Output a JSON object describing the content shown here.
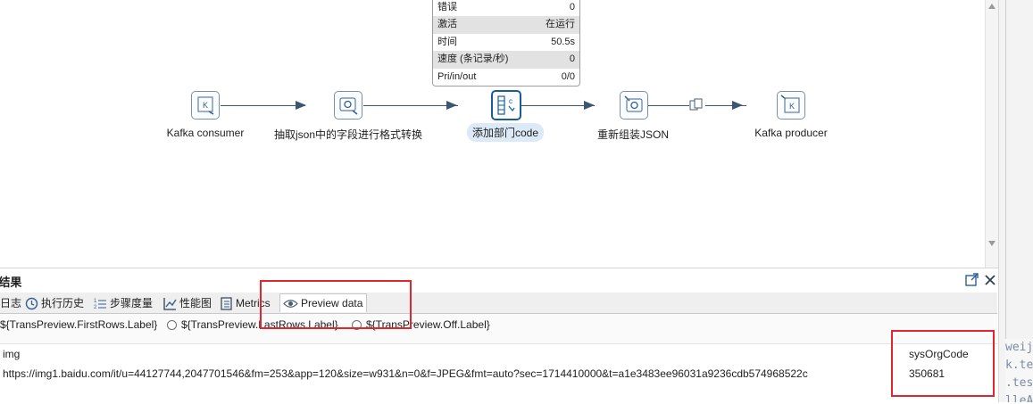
{
  "metrics_tooltip": [
    {
      "label": "错误",
      "value": "0"
    },
    {
      "label": "激活",
      "value": "在运行"
    },
    {
      "label": "时间",
      "value": "50.5s"
    },
    {
      "label": "速度 (条记录/秒)",
      "value": "0"
    },
    {
      "label": "Pri/in/out",
      "value": "0/0"
    }
  ],
  "steps": [
    {
      "label": "Kafka consumer"
    },
    {
      "label": "抽取json中的字段进行格式转换"
    },
    {
      "label": "添加部门code"
    },
    {
      "label": "重新组装JSON"
    },
    {
      "label": "Kafka producer"
    }
  ],
  "panel": {
    "title": "f结果",
    "tabs": [
      {
        "label": "日志"
      },
      {
        "label": "执行历史"
      },
      {
        "label": "步骤度量"
      },
      {
        "label": "性能图"
      },
      {
        "label": "Metrics"
      },
      {
        "label": "Preview data"
      }
    ],
    "radios": [
      {
        "label": "${TransPreview.FirstRows.Label}"
      },
      {
        "label": "${TransPreview.LastRows.Label}"
      },
      {
        "label": "${TransPreview.Off.Label}"
      }
    ],
    "columns": [
      "img",
      "sysOrgCode"
    ],
    "rows": [
      [
        "https://img1.baidu.com/it/u=44127744,2047701546&fm=253&app=120&size=w931&n=0&f=JPEG&fmt=auto?sec=1714410000&t=a1e3483ee96031a9236cdb574968522c",
        "350681"
      ]
    ]
  },
  "side_code": [
    "weij",
    "k.te",
    ".tes",
    "lleA"
  ],
  "colors": {
    "highlight": "#e0262e",
    "selected_step": "#1a5c99",
    "hop": "#3b5670"
  }
}
